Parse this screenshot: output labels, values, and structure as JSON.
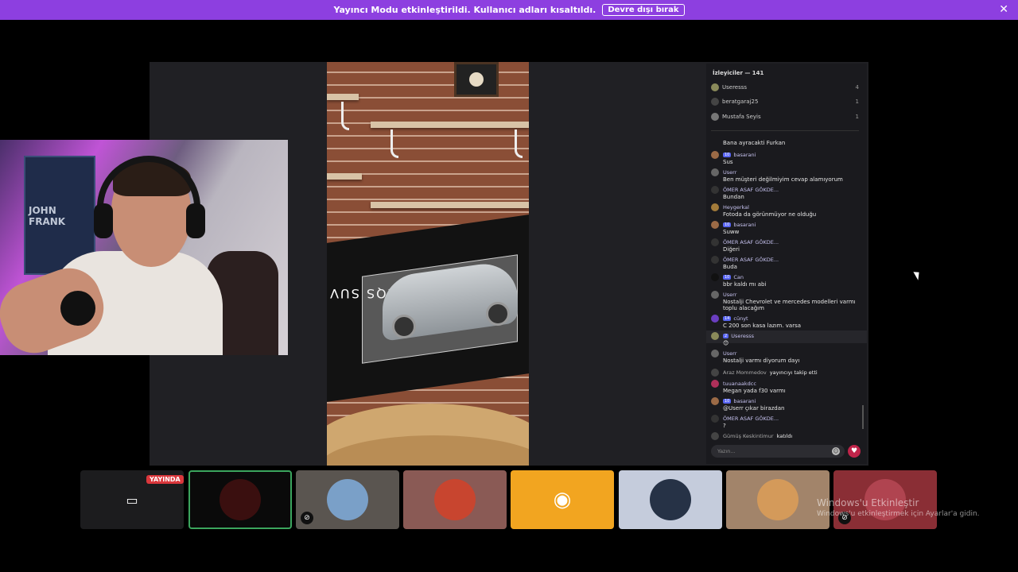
{
  "banner": {
    "message": "Yayıncı Modu etkinleştirildi. Kullanıcı adları kısaltıldı.",
    "button": "Devre dışı bırak",
    "close": "✕"
  },
  "video": {
    "box_text": "EQS SUV"
  },
  "webcam": {
    "poster_text": "JOHN FRANK"
  },
  "chat": {
    "viewers_header": "İzleyiciler — 141",
    "viewers": [
      {
        "name": "Useresss",
        "count": "4"
      },
      {
        "name": "beratgaraj25",
        "count": "1"
      },
      {
        "name": "Mustafa Seyis",
        "count": "1"
      }
    ],
    "messages": [
      {
        "author": "",
        "badge": "",
        "text": "Bana ayracakti Furkan"
      },
      {
        "author": "basarani",
        "badge": "10",
        "text": "Sus"
      },
      {
        "author": "Userr",
        "badge": "",
        "text": "Ben müşteri değilmiyim cevap alamıyorum"
      },
      {
        "author": "ÖMER ASAF GÖKDE...",
        "badge": "",
        "text": "Bundan"
      },
      {
        "author": "Heygerkal",
        "badge": "",
        "text": "Fotoda da görünmüyor ne olduğu"
      },
      {
        "author": "basarani",
        "badge": "10",
        "text": "Suww"
      },
      {
        "author": "ÖMER ASAF GÖKDE...",
        "badge": "",
        "text": "Diğeri"
      },
      {
        "author": "ÖMER ASAF GÖKDE...",
        "badge": "",
        "text": "Buda"
      },
      {
        "author": "Can",
        "badge": "10",
        "text": "bbr kaldı mı abi"
      },
      {
        "author": "Userr",
        "badge": "",
        "text": "Nostalji Chevrolet ve mercedes modelleri varmı toplu alacağım"
      },
      {
        "author": "cünyt",
        "badge": "14",
        "text": "C 200 son kasa lazım. varsa"
      },
      {
        "author": "Useresss",
        "badge": "2",
        "text": "😊"
      },
      {
        "author": "Userr",
        "badge": "",
        "text": "Nostalji varmı diyorum dayı"
      }
    ],
    "event1": {
      "name": "Araz Mommedov",
      "text": "yayıncıyı takip etti"
    },
    "messages2": [
      {
        "author": "tuuanaakdcc",
        "badge": "",
        "text": "Megan yada f30 varmı"
      },
      {
        "author": "basarani",
        "badge": "10",
        "text": "@Userr çıkar birazdan"
      },
      {
        "author": "ÖMER ASAF GÖKDE...",
        "badge": "",
        "text": "?"
      }
    ],
    "event2": {
      "name": "Gümüş Keskintimur",
      "text": "katıldı"
    },
    "input_placeholder": "Yazın..."
  },
  "bottom": {
    "live_label": "YAYINDA"
  },
  "watermark": {
    "line1": "Windows'u Etkinleştir",
    "line2": "Windows'u etkinleştirmek için Ayarlar'a gidin."
  }
}
